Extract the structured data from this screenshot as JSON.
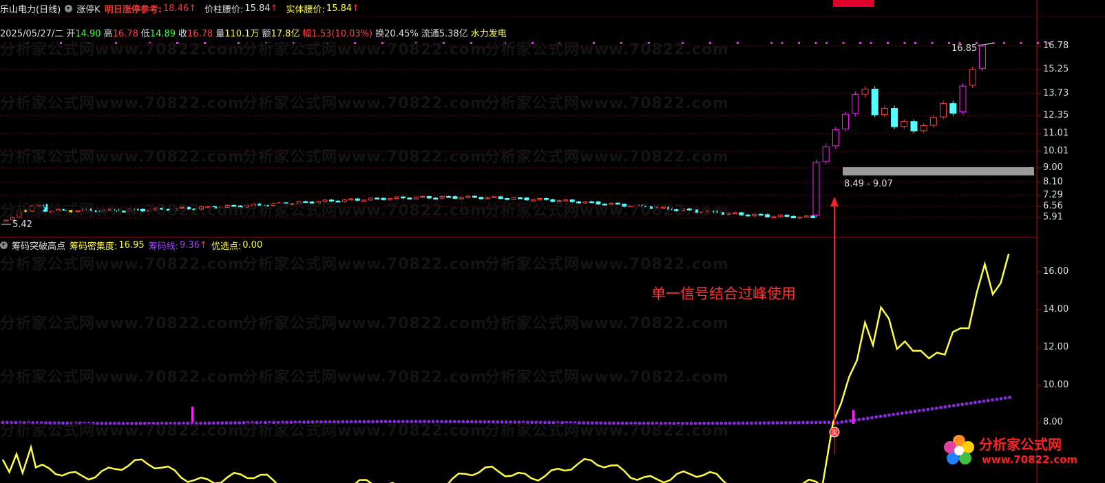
{
  "header": {
    "stock_name": "乐山电力(日线)",
    "indicator1_name": "涨停K",
    "next_limit_label": "明日涨停参考:",
    "next_limit_value": "18.46",
    "pillar_mid_label": "价柱腰价:",
    "pillar_mid_value": "15.84",
    "body_mid_label": "实体腰价:",
    "body_mid_value": "15.84",
    "up_arrow": "↑"
  },
  "quote": {
    "date": "2025/05/27/二",
    "open_label": "开",
    "open": "14.90",
    "high_label": "高",
    "high": "16.78",
    "low_label": "低",
    "low": "14.89",
    "close_label": "收",
    "close": "16.78",
    "vol_label": "量",
    "vol": "110.1万",
    "amount_label": "额",
    "amount": "17.8亿",
    "change_label": "幅",
    "change": "1.53(10.03%)",
    "turnover_label": "换",
    "turnover": "20.45%",
    "float_label": "流通",
    "float": "5.38亿",
    "sector": "水力发电"
  },
  "upper_axis": [
    "16.78",
    "15.25",
    "13.73",
    "12.35",
    "11.01",
    "10.01",
    "9.00",
    "8.10",
    "7.29",
    "6.56",
    "5.91"
  ],
  "upper_annotations": {
    "high_marker": "16.85",
    "low_marker": "5.42",
    "range_box": "8.49 - 9.07"
  },
  "lower_header": {
    "indicator_name": "筹码突破高点",
    "density_label": "筹码密集度:",
    "density_value": "16.95",
    "chip_line_label": "筹码线:",
    "chip_line_value": "9.36",
    "pick_label": "优选点:",
    "pick_value": "0.00"
  },
  "lower_axis": [
    "16.00",
    "14.00",
    "12.00",
    "10.00",
    "8.00"
  ],
  "annotation_text": "单一信号结合过峰使用",
  "watermark": "分析家公式网www.70822.com",
  "logo": {
    "name": "分析家公式网",
    "url": "www.70822.com"
  },
  "signal_marker": "买",
  "colors": {
    "up": "#ff4040",
    "down": "#54ffff",
    "limit_up": "#ff20ff",
    "yellow_line": "#ffff40",
    "purple_dots": "#8a2be2",
    "grid": "#8b0000"
  },
  "chart_data": {
    "type": "candlestick",
    "upper_ylim": [
      5.42,
      16.85
    ],
    "lower_ylim": [
      7.0,
      17.0
    ],
    "closes_tail": [
      8.49,
      9.34,
      10.27,
      11.3,
      12.43,
      13.67,
      14.01,
      12.4,
      12.8,
      11.52,
      11.9,
      11.2,
      11.6,
      12.2,
      13.1,
      12.5,
      14.2,
      15.25,
      16.78
    ],
    "density_tail": [
      8.0,
      9.0,
      10.4,
      11.3,
      13.3,
      12.1,
      14.1,
      13.5,
      11.9,
      12.3,
      11.8,
      11.8,
      11.4,
      11.7,
      11.6,
      12.8,
      13.0,
      13.0,
      14.9,
      16.4,
      14.8,
      15.4,
      16.95
    ]
  }
}
